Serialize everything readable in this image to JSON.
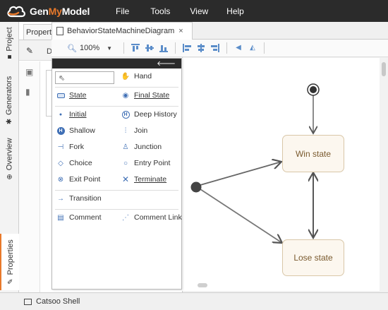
{
  "app": {
    "logo_text_1": "Gen",
    "logo_text_2": "My",
    "logo_text_3": "Model",
    "menu": [
      "File",
      "Tools",
      "View",
      "Help"
    ]
  },
  "left_rail": {
    "tabs": [
      "Project",
      "Generators",
      "Overview",
      "Properties"
    ]
  },
  "properties_panel": {
    "tab_label": "Properties",
    "d_label": "D"
  },
  "editor": {
    "tab_title": "BehaviorStateMachineDiagram",
    "close_glyph": "×",
    "zoom_value": "100%"
  },
  "palette": {
    "search_placeholder": "",
    "hand": "Hand",
    "state": "State",
    "final_state": "Final State",
    "initial": "Initial",
    "deep_history": "Deep History",
    "shallow": "Shallow",
    "join": "Join",
    "fork": "Fork",
    "junction": "Junction",
    "choice": "Choice",
    "entry_point": "Entry Point",
    "exit_point": "Exit Point",
    "terminate": "Terminate",
    "transition": "Transition",
    "comment": "Comment",
    "comment_link": "Comment Link"
  },
  "diagram": {
    "states": {
      "win": "Win state",
      "lose": "Lose state"
    }
  },
  "bottom": {
    "shell_label": "Catsoo Shell"
  },
  "colors": {
    "accent": "#e8792b",
    "appbar": "#2b2b2b",
    "palette_icon": "#3f6fb5",
    "state_fill": "#fcf7ef",
    "state_border": "#d9c7a8"
  }
}
